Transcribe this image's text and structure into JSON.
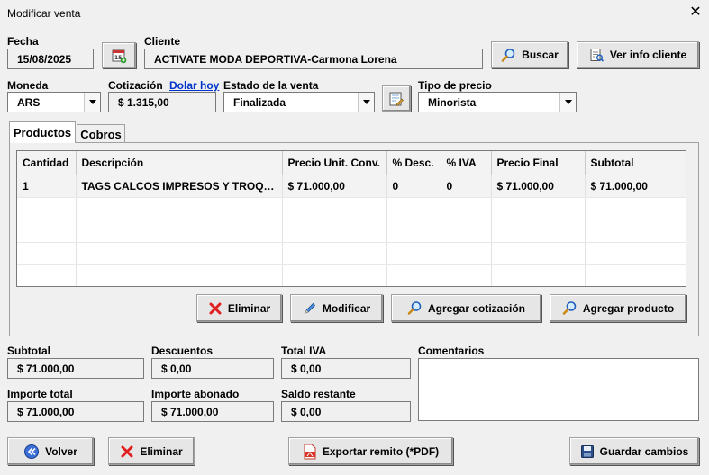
{
  "window": {
    "title": "Modificar venta",
    "close_glyph": "✕"
  },
  "fecha": {
    "label": "Fecha",
    "value": "15/08/2025"
  },
  "cliente": {
    "label": "Cliente",
    "value": "ACTIVATE MODA DEPORTIVA-Carmona Lorena"
  },
  "buttons": {
    "buscar": "Buscar",
    "ver_info_cliente": "Ver info cliente",
    "eliminar_item": "Eliminar",
    "modificar": "Modificar",
    "agregar_cotizacion": "Agregar cotización",
    "agregar_producto": "Agregar producto",
    "volver": "Volver",
    "eliminar_venta": "Eliminar",
    "exportar_remito": "Exportar remito (*PDF)",
    "guardar_cambios": "Guardar cambios"
  },
  "moneda": {
    "label": "Moneda",
    "value": "ARS"
  },
  "cotizacion": {
    "label": "Cotización",
    "link": "Dolar hoy",
    "value": "$ 1.315,00"
  },
  "estado": {
    "label": "Estado de la venta",
    "value": "Finalizada"
  },
  "tipo_precio": {
    "label": "Tipo de precio",
    "value": "Minorista"
  },
  "tabs": [
    {
      "label": "Productos"
    },
    {
      "label": "Cobros"
    }
  ],
  "table": {
    "columns": [
      "Cantidad",
      "Descripción",
      "Precio Unit. Conv.",
      "% Desc.",
      "% IVA",
      "Precio Final",
      "Subtotal"
    ],
    "rows": [
      [
        "1",
        "TAGS CALCOS IMPRESOS Y TROQUE...",
        "$ 71.000,00",
        "0",
        "0",
        "$ 71.000,00",
        "$ 71.000,00"
      ]
    ]
  },
  "totals": {
    "subtotal": {
      "label": "Subtotal",
      "value": "$ 71.000,00"
    },
    "descuentos": {
      "label": "Descuentos",
      "value": "$ 0,00"
    },
    "total_iva": {
      "label": "Total IVA",
      "value": "$ 0,00"
    },
    "importe_total": {
      "label": "Importe total",
      "value": "$ 71.000,00"
    },
    "importe_abonado": {
      "label": "Importe abonado",
      "value": "$ 71.000,00"
    },
    "saldo_restante": {
      "label": "Saldo restante",
      "value": "$ 0,00"
    }
  },
  "comentarios": {
    "label": "Comentarios",
    "value": ""
  },
  "colors": {
    "link": "#0033cc",
    "delete_red": "#e02020",
    "accent_blue": "#1e5fbf"
  }
}
